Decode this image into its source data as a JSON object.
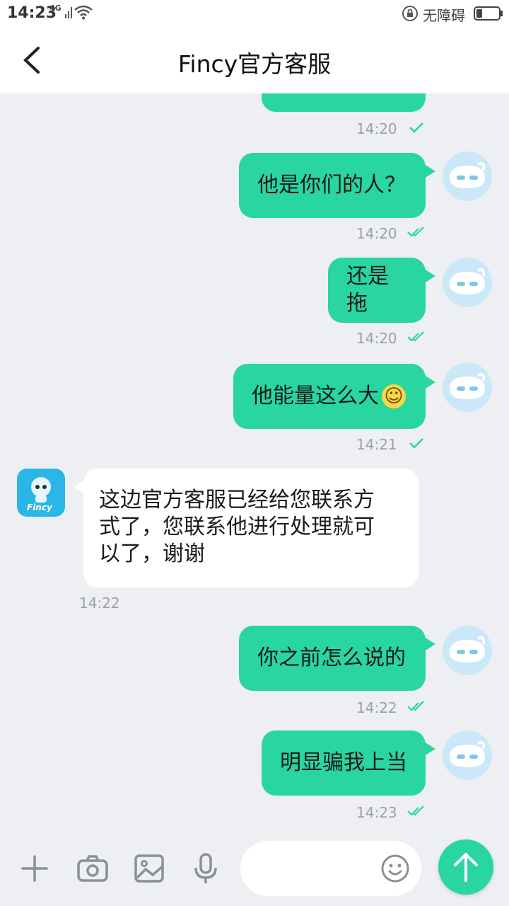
{
  "status_bar": {
    "time": "14:23",
    "network": "4G",
    "accessibility": "无障碍"
  },
  "header": {
    "title": "Fincy官方客服"
  },
  "bot": {
    "brand": "Fincy"
  },
  "messages": [
    {
      "side": "me",
      "text": "",
      "time": "14:20",
      "read": false
    },
    {
      "side": "me",
      "text": "他是你们的人？",
      "time": "14:20",
      "read": true
    },
    {
      "side": "me",
      "text": "还是拖",
      "time": "14:20",
      "read": true
    },
    {
      "side": "me",
      "text": "他能量这么大",
      "emoji": "☺",
      "time": "14:21",
      "read": false
    },
    {
      "side": "them",
      "lines": [
        "这边官方客服已经给您联系方",
        "式了，您联系他进行处理就可",
        "以了，谢谢"
      ],
      "time": "14:22"
    },
    {
      "side": "me",
      "text": "你之前怎么说的",
      "time": "14:22",
      "read": true
    },
    {
      "side": "me",
      "text": "明显骗我上当",
      "time": "14:23",
      "read": true
    }
  ],
  "input": {
    "placeholder": ""
  },
  "colors": {
    "accent": "#29d6a0",
    "background": "#eeeff3",
    "bubble_me": "#29d6a0",
    "bubble_them": "#ffffff"
  }
}
